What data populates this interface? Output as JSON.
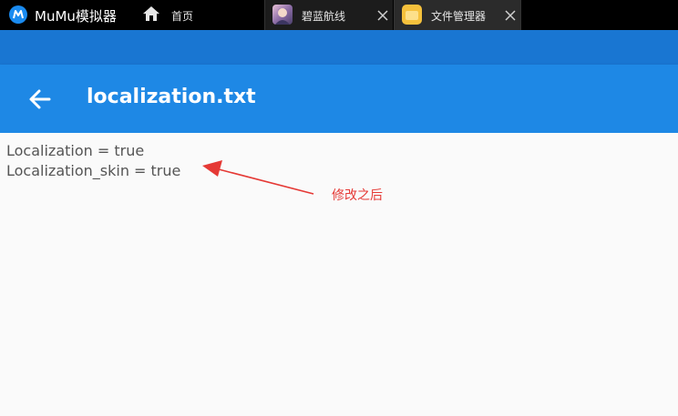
{
  "emulator": {
    "brand": "MuMu模拟器",
    "tabs": [
      {
        "label": "首页",
        "icon": "home-icon",
        "closable": false
      },
      {
        "label": "碧蓝航线",
        "icon": "game-icon",
        "closable": true
      },
      {
        "label": "文件管理器",
        "icon": "folder-icon",
        "closable": true,
        "active": true
      }
    ]
  },
  "appbar": {
    "title": "localization.txt",
    "back_icon": "arrow-left-icon"
  },
  "file": {
    "lines": [
      "Localization = true",
      "Localization_skin = true"
    ]
  },
  "annotation": {
    "label": "修改之后",
    "color": "#e53935"
  },
  "colors": {
    "status_bar": "#1976d2",
    "app_bar": "#1e88e5",
    "background": "#fafafa"
  }
}
